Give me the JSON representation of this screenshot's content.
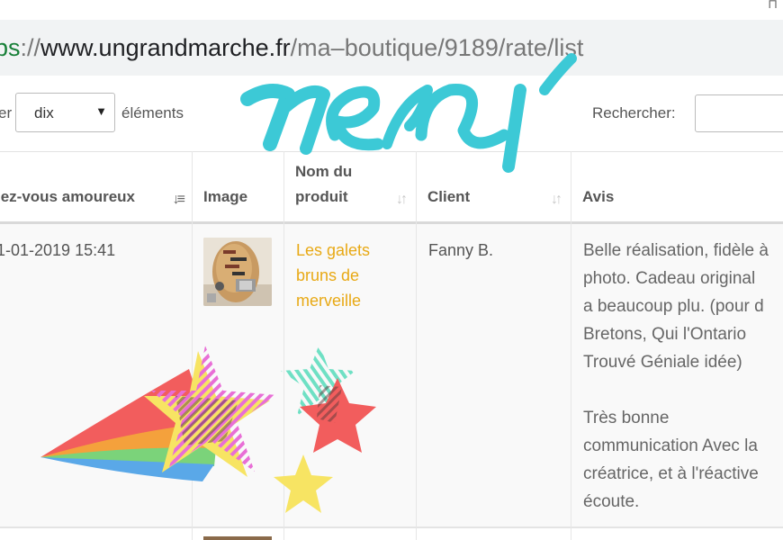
{
  "browser": {
    "url_protocol": "ps",
    "url_sep": "://",
    "url_host": "www.ungrandmarche.fr",
    "url_path": "/ma–boutique/9189/rate/list",
    "corner_glyph": "⊓"
  },
  "controls": {
    "show_label": "er",
    "length_value": "dix",
    "elements_label": "éléments",
    "search_label": "Rechercher:",
    "search_value": ""
  },
  "table": {
    "columns": [
      {
        "label": "lez-vous amoureux"
      },
      {
        "label": "Image"
      },
      {
        "label_line1": "Nom du",
        "label_line2": "produit"
      },
      {
        "label": "Client"
      },
      {
        "label": "Avis"
      }
    ],
    "rows": [
      {
        "date": "1-01-2019 15:41",
        "image": "pebble-art-thumbnail",
        "product_line1": "Les galets",
        "product_line2": "bruns de",
        "product_line3": "merveille",
        "client": "Fanny B.",
        "review_lines_1": [
          "Belle réalisation, fidèle à",
          "photo. Cadeau original",
          "a beaucoup plu. (pour d",
          "Bretons, Qui l'Ontario",
          "Trouvé Géniale idée)"
        ],
        "review_lines_2": [
          "Très bonne",
          "communication Avec la",
          "créatrice, et à l'réactive",
          "écoute."
        ]
      }
    ]
  },
  "sticker": {
    "text": "merci",
    "colors": {
      "teal": "#3cc9d6",
      "red": "#f25d5d",
      "yellow": "#f7e463",
      "pink": "#e86fd6",
      "green": "#7bd37a",
      "blue": "#5aa8e8",
      "orange": "#f4a13c",
      "mint": "#6fe0c4"
    }
  }
}
